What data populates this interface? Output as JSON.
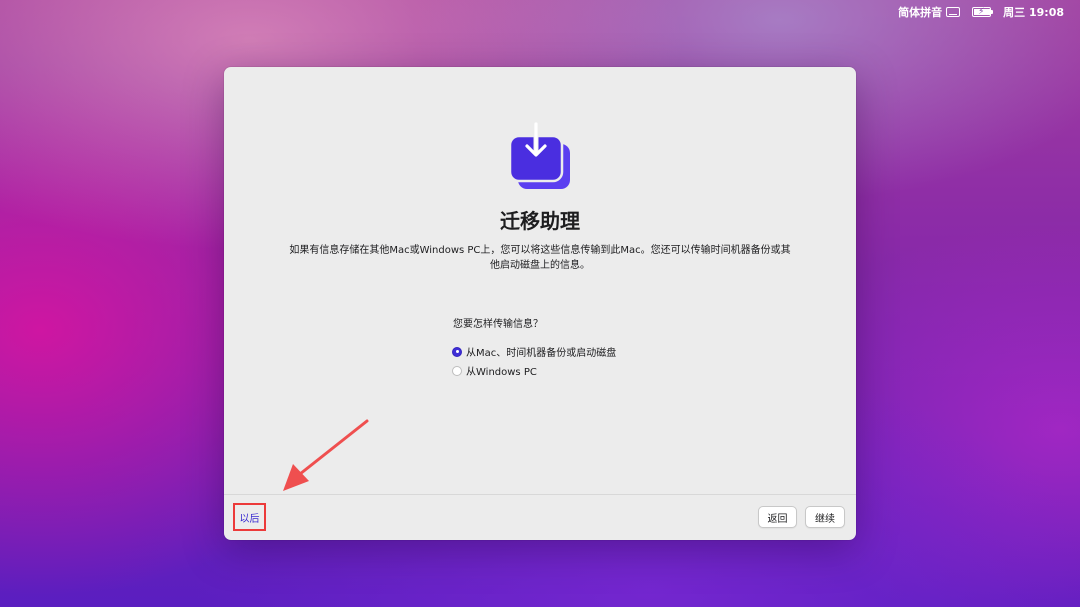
{
  "menubar": {
    "input_method": "简体拼音",
    "keyboard_icon": "keyboard-icon",
    "battery_icon": "battery-charging-icon",
    "battery_level": 1.0,
    "datetime": "周三 19:08"
  },
  "window": {
    "app_icon": "migration-assistant-icon",
    "title": "迁移助理",
    "description": "如果有信息存储在其他Mac或Windows PC上，您可以将这些信息传输到此Mac。您还可以传输时间机器备份或其他启动磁盘上的信息。",
    "question": "您要怎样传输信息？",
    "options": [
      {
        "label": "从Mac、时间机器备份或启动磁盘",
        "selected": true
      },
      {
        "label": "从Windows PC",
        "selected": false
      }
    ]
  },
  "footer": {
    "later_label": "以后",
    "back_label": "返回",
    "continue_label": "继续"
  },
  "colors": {
    "accent": "#3f2fd6",
    "highlight_box": "#ec3a3a",
    "annotation_arrow": "#ef4f4f"
  }
}
